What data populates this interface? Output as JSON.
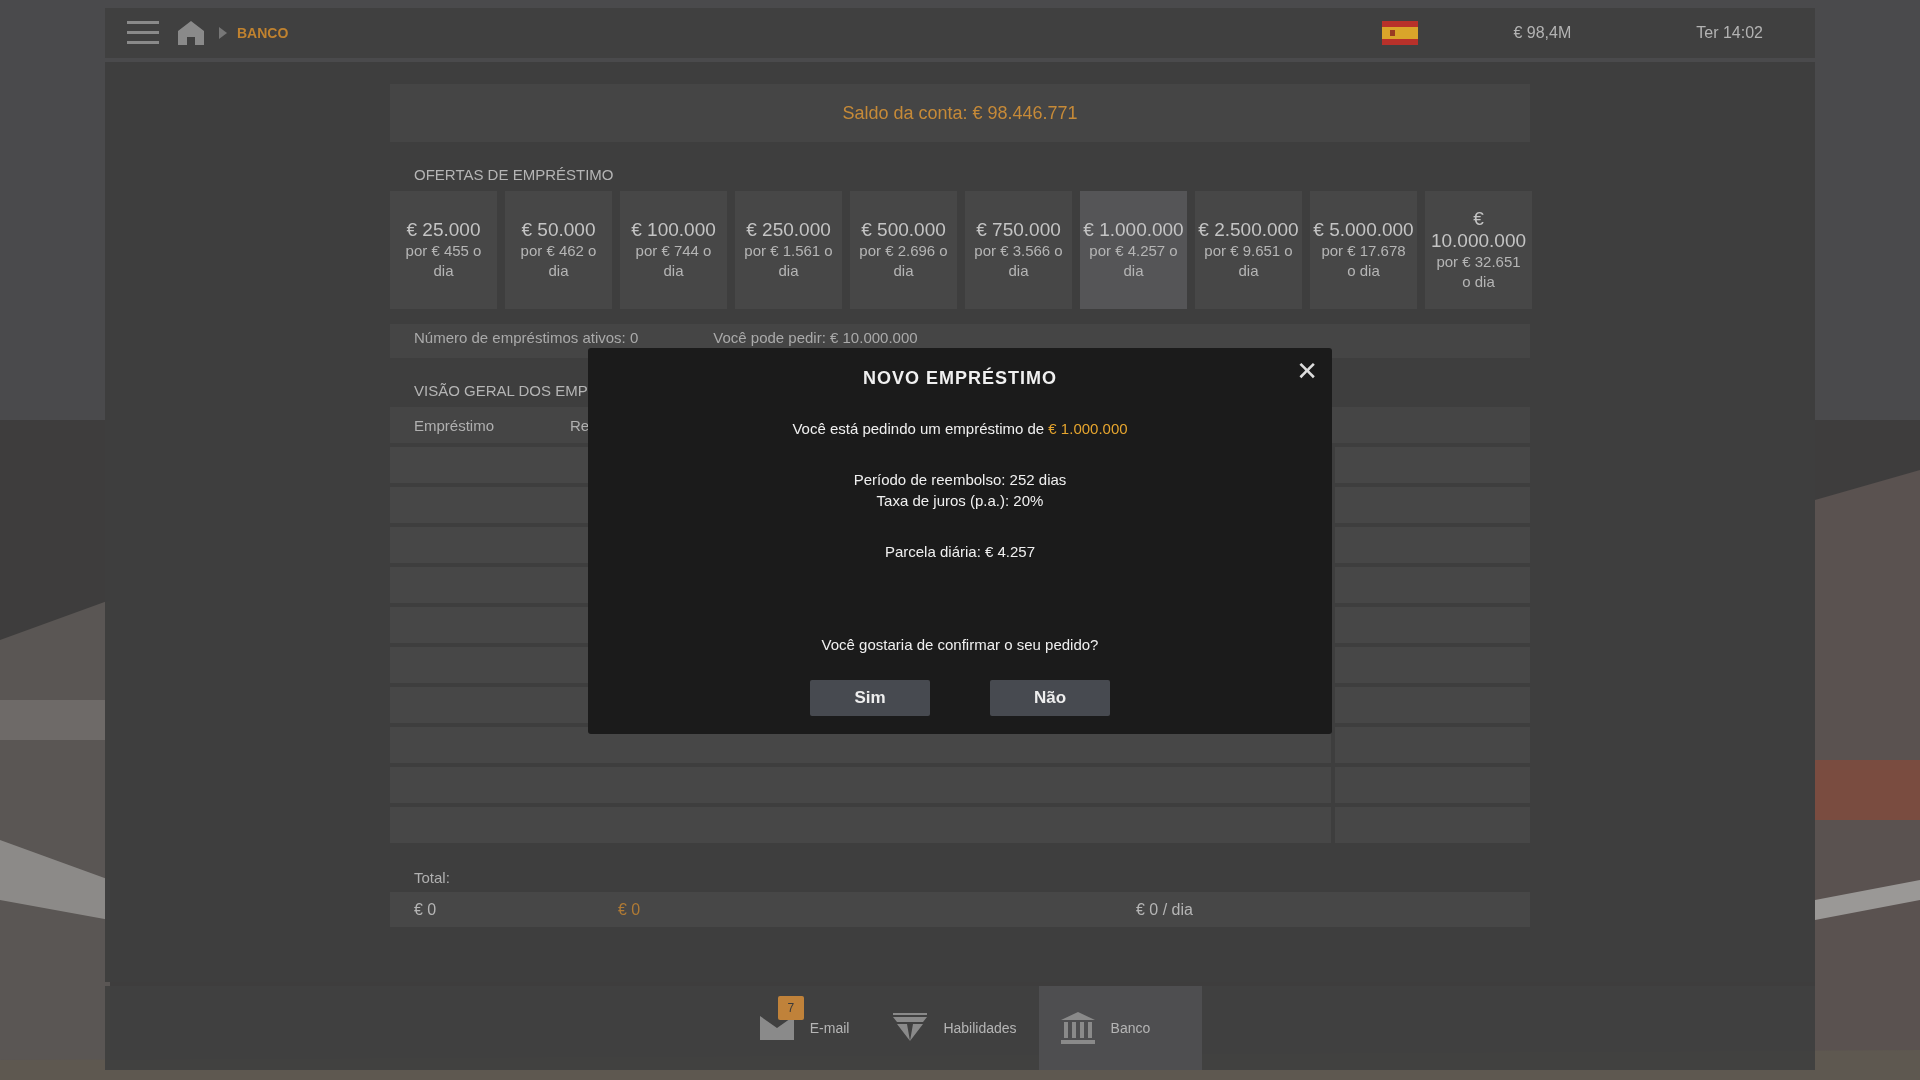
{
  "top_bar": {
    "breadcrumb": "BANCO",
    "balance": "€ 98,4M",
    "clock": "Ter 14:02"
  },
  "account_balance": "Saldo da conta: € 98.446.771",
  "offers_title": "OFERTAS DE EMPRÉSTIMO",
  "offers": [
    {
      "amount": "€ 25.000",
      "rate": "por € 455 o dia",
      "selected": false
    },
    {
      "amount": "€ 50.000",
      "rate": "por € 462 o dia",
      "selected": false
    },
    {
      "amount": "€ 100.000",
      "rate": "por € 744 o dia",
      "selected": false
    },
    {
      "amount": "€ 250.000",
      "rate": "por € 1.561 o dia",
      "selected": false
    },
    {
      "amount": "€ 500.000",
      "rate": "por € 2.696 o dia",
      "selected": false
    },
    {
      "amount": "€ 750.000",
      "rate": "por € 3.566 o dia",
      "selected": false
    },
    {
      "amount": "€ 1.000.000",
      "rate": "por € 4.257 o dia",
      "selected": true
    },
    {
      "amount": "€ 2.500.000",
      "rate": "por € 9.651 o dia",
      "selected": false
    },
    {
      "amount": "€ 5.000.000",
      "rate": "por € 17.678 o dia",
      "selected": false
    },
    {
      "amount": "€ 10.000.000",
      "rate": "por € 32.651 o dia",
      "selected": false
    }
  ],
  "loan_info": {
    "active_loans": "Número de empréstimos ativos: 0",
    "can_request": "Você pode pedir: € 10.000.000"
  },
  "overview_title": "VISÃO GERAL DOS EMP",
  "table": {
    "columns": [
      "Empréstimo",
      "Re"
    ]
  },
  "totals": {
    "label": "Total:",
    "loan": "€ 0",
    "remaining": "€ 0",
    "installment": "€ 0 / dia"
  },
  "dialog": {
    "title": "NOVO EMPRÉSTIMO",
    "close": "✕",
    "request": "Você está pedindo um empréstimo de **€ 1.000.000**",
    "period": "Período de reembolso: 252 dias",
    "interest": "Taxa de juros (p.a.): 20%",
    "daily": "Parcela diária: € 4.257",
    "question": "Você gostaria de confirmar o seu pedido?",
    "buttons": [
      "Sim",
      "Não"
    ]
  },
  "bottom_nav": [
    {
      "kind": "mail",
      "label": "E-mail",
      "badge": "7",
      "selected": false
    },
    {
      "kind": "skills",
      "label": "Habilidades",
      "selected": false
    },
    {
      "kind": "bank",
      "label": "Banco",
      "selected": true
    }
  ]
}
